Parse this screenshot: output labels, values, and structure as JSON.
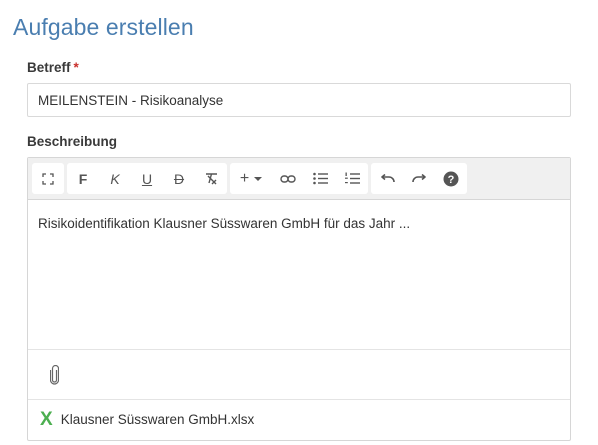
{
  "page": {
    "title": "Aufgabe erstellen"
  },
  "subject": {
    "label": "Betreff",
    "required_marker": "*",
    "value": "MEILENSTEIN - Risikoanalyse"
  },
  "description": {
    "label": "Beschreibung",
    "toolbar": {
      "fullscreen": {
        "icon": "fullscreen-icon"
      },
      "bold": {
        "label": "F"
      },
      "italic": {
        "label": "K"
      },
      "underline": {
        "label": "U"
      },
      "strikethrough": {
        "label": "D"
      },
      "clear_format": {
        "icon": "clear-format-icon"
      },
      "insert": {
        "label": "+",
        "icon": "chevron-down-icon"
      },
      "link": {
        "icon": "link-icon"
      },
      "bullet_list": {
        "icon": "bullet-list-icon"
      },
      "numbered_list": {
        "icon": "numbered-list-icon"
      },
      "undo": {
        "icon": "undo-icon"
      },
      "redo": {
        "icon": "redo-icon"
      },
      "help": {
        "icon": "help-icon"
      }
    },
    "content": "Risikoidentifikation Klausner Süsswaren GmbH für das Jahr ...",
    "attach": {
      "icon": "paperclip-icon"
    },
    "attachments": [
      {
        "icon": "excel-icon",
        "icon_glyph": "X",
        "name": "Klausner Süsswaren GmbH.xlsx",
        "color": "#4caf50"
      }
    ]
  },
  "colors": {
    "title": "#4a7eb0",
    "required": "#c9302c",
    "toolbar_bg": "#f0f0f0"
  }
}
